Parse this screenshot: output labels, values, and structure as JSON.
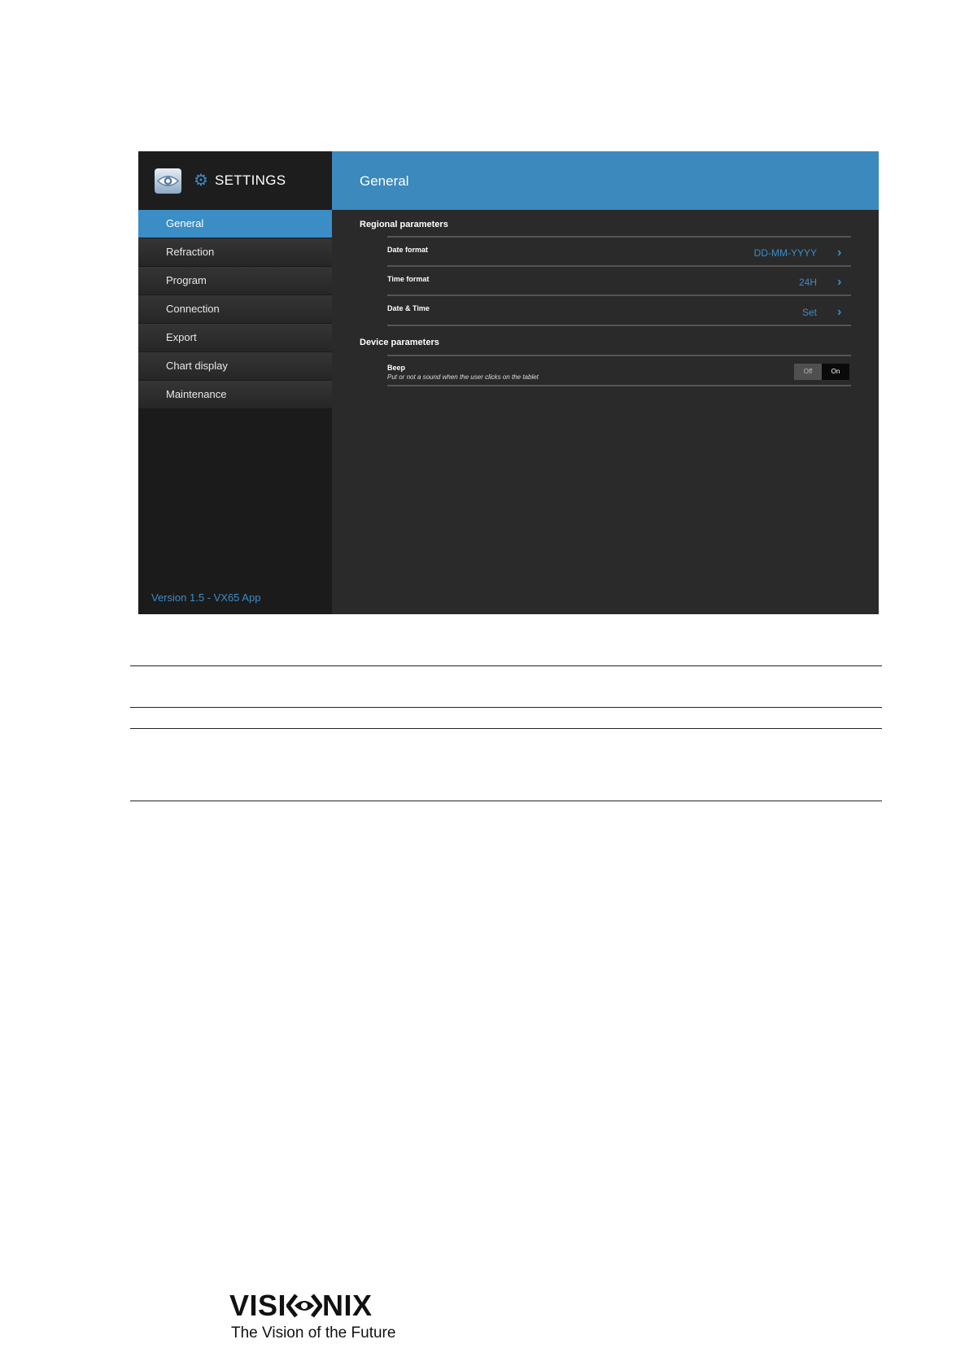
{
  "sidebar": {
    "title": "SETTINGS",
    "items": [
      {
        "label": "General",
        "active": true
      },
      {
        "label": "Refraction",
        "active": false
      },
      {
        "label": "Program",
        "active": false
      },
      {
        "label": "Connection",
        "active": false
      },
      {
        "label": "Export",
        "active": false
      },
      {
        "label": "Chart display",
        "active": false
      },
      {
        "label": "Maintenance",
        "active": false
      }
    ],
    "version": "Version 1.5 - VX65 App"
  },
  "header": {
    "title": "General"
  },
  "regional": {
    "title": "Regional parameters",
    "date_format": {
      "label": "Date format",
      "value": "DD-MM-YYYY"
    },
    "time_format": {
      "label": "Time format",
      "value": "24H"
    },
    "date_time": {
      "label": "Date & Time",
      "value": "Set"
    }
  },
  "device": {
    "title": "Device parameters",
    "beep": {
      "label": "Beep",
      "description": "Put or not a sound when the user clicks on the tablet",
      "off_label": "Off",
      "on_label": "On",
      "state": "On"
    }
  },
  "icons": {
    "gear": "gear-icon",
    "chevron": "chevron-right-icon",
    "app_logo": "eye-logo-icon"
  },
  "colors": {
    "accent": "#3b8dc6",
    "header": "#3b89bd",
    "sidebar_bg": "#1b1b1b",
    "content_bg": "#2a2a2a"
  },
  "footer": {
    "brand_left": "VISI",
    "brand_right": "NIX",
    "tagline": "The Vision of the Future"
  }
}
